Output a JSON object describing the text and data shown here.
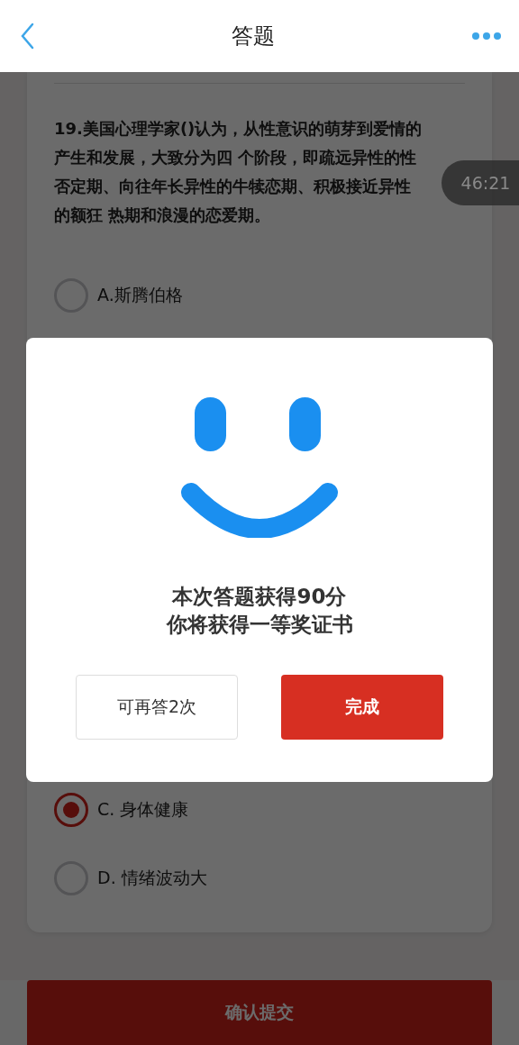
{
  "header": {
    "title": "答题"
  },
  "question": {
    "lines": [
      "19.美国心理学家()认为，从性意识的萌芽到爱情的",
      "产生和发展，大致分为四 个阶段，即疏远异性的性",
      "否定期、向往年长异性的牛犊恋期、积极接近异性",
      "的额狂 热期和浪漫的恋爱期。"
    ]
  },
  "options": [
    {
      "label": "A.斯腾伯格",
      "selected": false
    },
    {
      "label": "C. 身体健康",
      "selected": true
    },
    {
      "label": "D. 情绪波动大",
      "selected": false
    }
  ],
  "submit_button": "确认提交",
  "timer": "46:21",
  "result_dialog": {
    "lines": [
      "本次答题获得90分",
      "你将获得一等奖证书"
    ],
    "retry_button": "可再答2次",
    "done_button": "完成"
  }
}
